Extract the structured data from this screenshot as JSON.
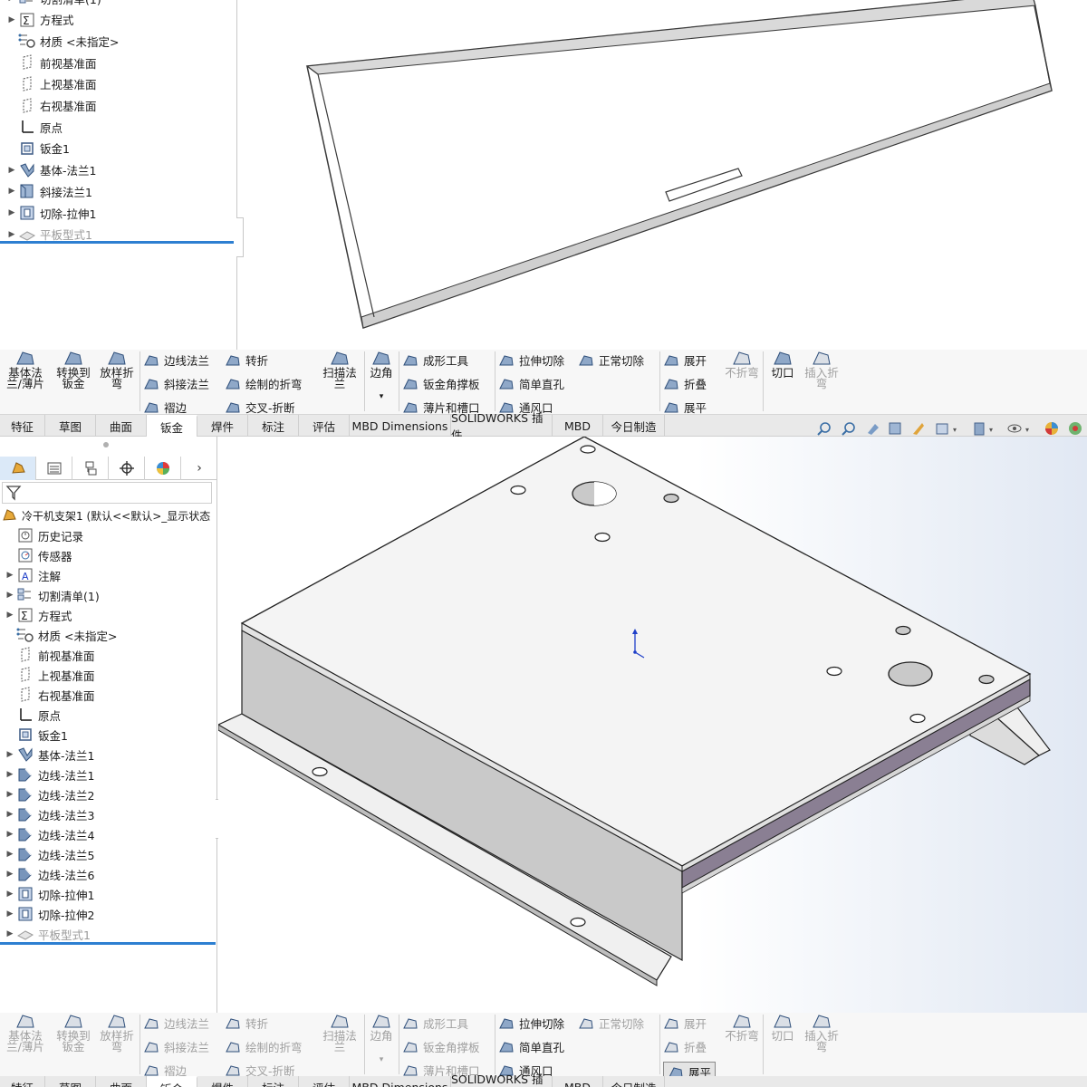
{
  "top_tree": {
    "items": [
      {
        "label": "切割清单(1)",
        "icon": "cut-list-icon",
        "caret": true
      },
      {
        "label": "方程式",
        "icon": "equation-icon",
        "caret": true
      },
      {
        "label": "材质 <未指定>",
        "icon": "material-icon",
        "caret": false
      },
      {
        "label": "前视基准面",
        "icon": "plane-icon",
        "caret": false
      },
      {
        "label": "上视基准面",
        "icon": "plane-icon",
        "caret": false
      },
      {
        "label": "右视基准面",
        "icon": "plane-icon",
        "caret": false
      },
      {
        "label": "原点",
        "icon": "origin-icon",
        "caret": false
      },
      {
        "label": "钣金1",
        "icon": "sheet-metal-icon",
        "caret": false
      },
      {
        "label": "基体-法兰1",
        "icon": "base-flange-icon",
        "caret": true
      },
      {
        "label": "斜接法兰1",
        "icon": "miter-flange-icon",
        "caret": true
      },
      {
        "label": "切除-拉伸1",
        "icon": "extruded-cut-icon",
        "caret": true
      },
      {
        "label": "平板型式1",
        "icon": "flat-pattern-icon",
        "caret": true,
        "dim": true
      }
    ]
  },
  "ribbon": {
    "base_flange": "基体法\n兰/薄片",
    "convert": "转换到\n钣金",
    "loft_bend": "放样折\n弯",
    "edge_flange": "边线法兰",
    "miter_flange": "斜接法兰",
    "hem": "褶边",
    "jog": "转折",
    "sketched_bend": "绘制的折弯",
    "cross_break": "交叉-折断",
    "swept_flange": "扫描法\n兰",
    "corners": "边角",
    "forming_tool": "成形工具",
    "gusset": "钣金角撑板",
    "tab_slot": "薄片和槽口",
    "extruded_cut": "拉伸切除",
    "normal_cut": "正常切除",
    "simple_hole": "简单直孔",
    "vent": "通风口",
    "unfold": "展开",
    "fold": "折叠",
    "flatten": "展平",
    "no_bends": "不折弯",
    "rip": "切口",
    "insert_bends": "插入折\n弯"
  },
  "tabs": [
    "特征",
    "草图",
    "曲面",
    "钣金",
    "焊件",
    "标注",
    "评估",
    "MBD Dimensions",
    "SOLIDWORKS 插件",
    "MBD",
    "今日制造"
  ],
  "active_tab": "钣金",
  "tree": {
    "root": "冷干机支架1 (默认<<默认>_显示状态",
    "items": [
      {
        "label": "历史记录",
        "icon": "history-icon",
        "caret": false
      },
      {
        "label": "传感器",
        "icon": "sensor-icon",
        "caret": false
      },
      {
        "label": "注解",
        "icon": "annotation-icon",
        "caret": true
      },
      {
        "label": "切割清单(1)",
        "icon": "cut-list-icon",
        "caret": true
      },
      {
        "label": "方程式",
        "icon": "equation-icon",
        "caret": true
      },
      {
        "label": "材质 <未指定>",
        "icon": "material-icon",
        "caret": false
      },
      {
        "label": "前视基准面",
        "icon": "plane-icon",
        "caret": false
      },
      {
        "label": "上视基准面",
        "icon": "plane-icon",
        "caret": false
      },
      {
        "label": "右视基准面",
        "icon": "plane-icon",
        "caret": false
      },
      {
        "label": "原点",
        "icon": "origin-icon",
        "caret": false
      },
      {
        "label": "钣金1",
        "icon": "sheet-metal-icon",
        "caret": false
      },
      {
        "label": "基体-法兰1",
        "icon": "base-flange-icon",
        "caret": true
      },
      {
        "label": "边线-法兰1",
        "icon": "edge-flange-icon",
        "caret": true
      },
      {
        "label": "边线-法兰2",
        "icon": "edge-flange-icon",
        "caret": true
      },
      {
        "label": "边线-法兰3",
        "icon": "edge-flange-icon",
        "caret": true
      },
      {
        "label": "边线-法兰4",
        "icon": "edge-flange-icon",
        "caret": true
      },
      {
        "label": "边线-法兰5",
        "icon": "edge-flange-icon",
        "caret": true
      },
      {
        "label": "边线-法兰6",
        "icon": "edge-flange-icon",
        "caret": true
      },
      {
        "label": "切除-拉伸1",
        "icon": "extruded-cut-icon",
        "caret": true
      },
      {
        "label": "切除-拉伸2",
        "icon": "extruded-cut-icon",
        "caret": true
      },
      {
        "label": "平板型式1",
        "icon": "flat-pattern-icon",
        "caret": true,
        "dim": true
      }
    ]
  },
  "colors": {
    "accent": "#2d7fd1",
    "ribbon_bg": "#f7f7f7",
    "part_face": "#f4f4f4",
    "part_side": "#c9c9c9"
  }
}
